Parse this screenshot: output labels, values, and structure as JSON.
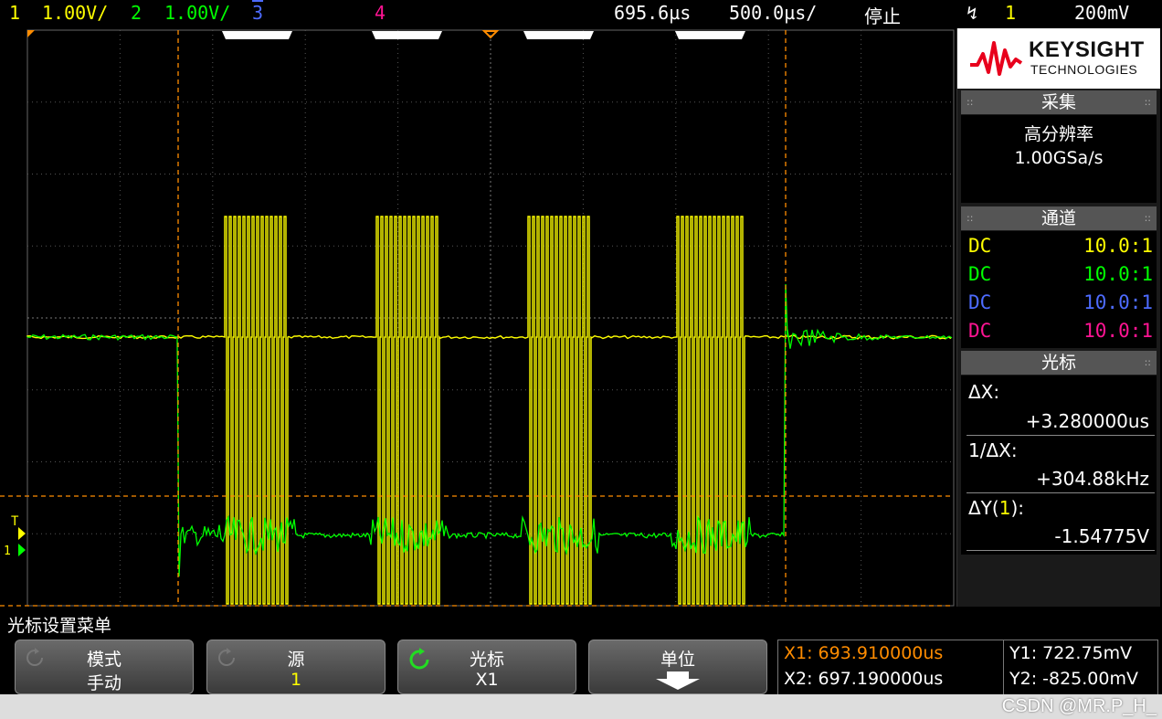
{
  "topbar": {
    "ch1_num": "1",
    "ch1_scale": "1.00V/",
    "ch2_num": "2",
    "ch2_scale": "1.00V/",
    "ch3_num": "3",
    "ch4_num": "4",
    "time_pos": "695.6µs",
    "time_scale": "500.0µs/",
    "run_state": "停止",
    "trigger_icon": "rising-edge-icon",
    "trigger_src": "1",
    "trigger_level": "200mV"
  },
  "colors": {
    "ch1": "#ffff00",
    "ch2": "#00ff00",
    "ch3": "#4d6bff",
    "ch4": "#ff1493",
    "cursor": "#ff8c00",
    "grid": "#555555"
  },
  "logo": {
    "brand": "KEYSIGHT",
    "sub": "TECHNOLOGIES"
  },
  "acquisition": {
    "title": "采集",
    "mode": "高分辨率",
    "rate": "1.00GSa/s"
  },
  "channels": {
    "title": "通道",
    "rows": [
      {
        "coupling": "DC",
        "probe": "10.0:1"
      },
      {
        "coupling": "DC",
        "probe": "10.0:1"
      },
      {
        "coupling": "DC",
        "probe": "10.0:1"
      },
      {
        "coupling": "DC",
        "probe": "10.0:1"
      }
    ]
  },
  "cursors": {
    "title": "光标",
    "dx_label": "ΔX:",
    "dx_value": "+3.280000us",
    "inv_label": "1/ΔX:",
    "inv_value": "+304.88kHz",
    "dy_label_pre": "ΔY(",
    "dy_label_ch": "1",
    "dy_label_post": "):",
    "dy_value": "-1.54775V"
  },
  "menu": {
    "title": "光标设置菜单",
    "keys": [
      {
        "label": "模式",
        "value": "手动"
      },
      {
        "label": "源",
        "value": "1"
      },
      {
        "label": "光标",
        "value": "X1"
      },
      {
        "label": "单位",
        "value": ""
      }
    ]
  },
  "readout": {
    "x1": "X1: 693.910000us",
    "x2": "X2: 697.190000us",
    "y1": "Y1: 722.75mV",
    "y2": "Y2: -825.00mV"
  },
  "watermark": "CSDN @MR.P_H_",
  "markers": {
    "trigger_marker": "T",
    "ground_marker": "1"
  }
}
